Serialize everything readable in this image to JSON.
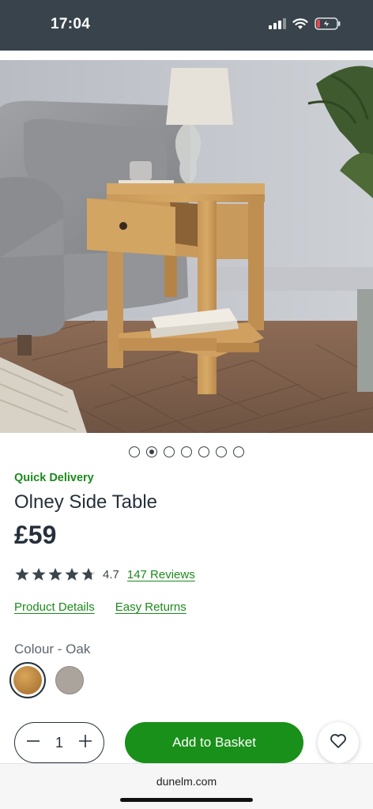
{
  "status_bar": {
    "time": "17:04",
    "icons": [
      "signal-icon",
      "wifi-icon",
      "battery-charging-icon"
    ],
    "battery_color": "#e5484d"
  },
  "hero": {
    "icon": "product-photo",
    "total_images": 7,
    "active_image": 2
  },
  "product": {
    "delivery_badge": "Quick Delivery",
    "title": "Olney Side Table",
    "price": "£59",
    "rating": 4.7,
    "rating_text": "4.7",
    "reviews_link": "147 Reviews",
    "links": [
      "Product Details",
      "Easy Returns"
    ],
    "colour_label": "Colour - Oak",
    "colours": [
      {
        "name": "Oak",
        "selected": true,
        "hex": "#c08a42"
      },
      {
        "name": "Grey",
        "selected": false,
        "hex": "#aba49c"
      }
    ]
  },
  "purchase": {
    "quantity": "1",
    "add_label": "Add to Basket",
    "button_color": "#199019"
  },
  "browser": {
    "url": "dunelm.com"
  },
  "colors": {
    "accent": "#1b8a1b",
    "text": "#25303b",
    "status_bar": "#38434c"
  }
}
